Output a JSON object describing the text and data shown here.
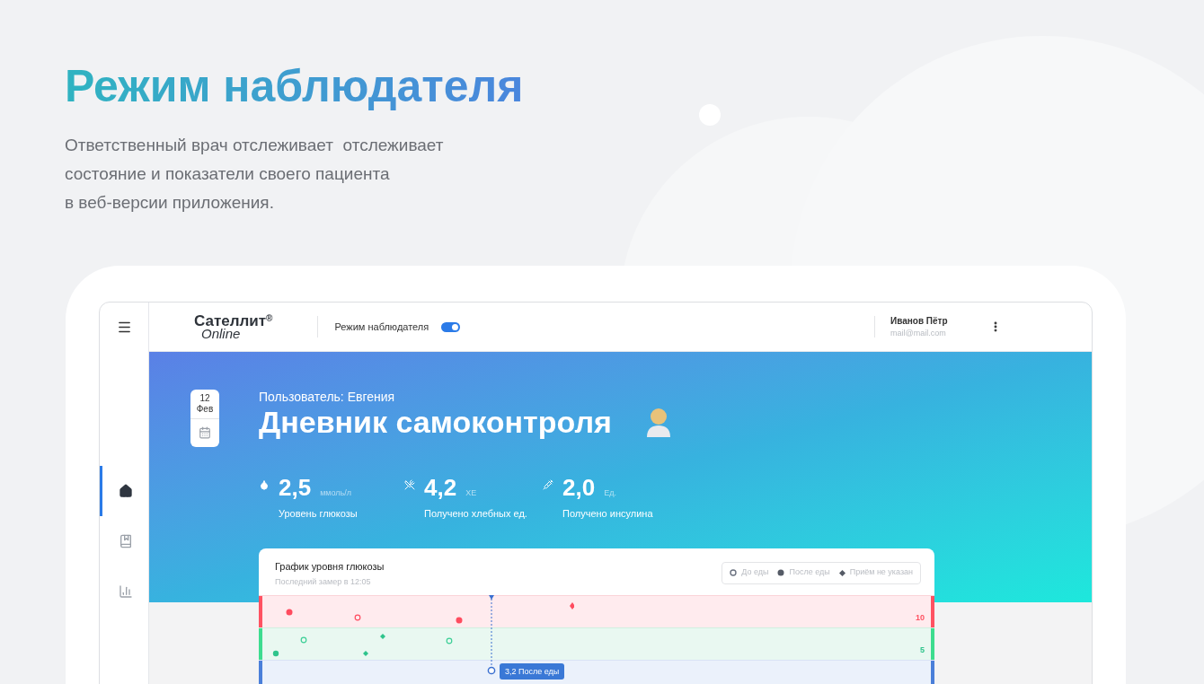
{
  "headline": "Режим наблюдателя",
  "description": "Ответственный врач отслеживает  отслеживает\nсостояние и показатели своего пациента\nв веб-версии приложения.",
  "app": {
    "sidebar": {
      "items": [
        {
          "kind": "home",
          "selected": true
        },
        {
          "kind": "diary",
          "selected": false
        },
        {
          "kind": "stats",
          "selected": false
        }
      ]
    },
    "header": {
      "logo": {
        "name": "Сателлит",
        "mark": "®",
        "sub": "Online"
      },
      "observer_mode": {
        "label": "Режим наблюдателя",
        "on": true
      },
      "user": {
        "name": "Иванов Пётр",
        "email": "mail@mail.com"
      }
    },
    "date": {
      "day": "12",
      "month": "Фев"
    },
    "user_label": "Пользователь: Евгения",
    "title": "Дневник самоконтроля",
    "stats": [
      {
        "kind": "glucose",
        "value": "2,5",
        "unit": "ммоль/л",
        "label": "Уровень глюкозы"
      },
      {
        "kind": "bread_units",
        "value": "4,2",
        "unit": "ХЕ",
        "label": "Получено хлебных ед."
      },
      {
        "kind": "insulin",
        "value": "2,0",
        "unit": "Ед.",
        "label": "Получено инсулина"
      }
    ],
    "chart": {
      "title": "График уровня глюкозы",
      "subtitle": "Последний замер в 12:05",
      "legend": [
        {
          "kind": "before",
          "label": "До еды"
        },
        {
          "kind": "after",
          "label": "После еды"
        },
        {
          "kind": "unspecified",
          "label": "Приём не указан"
        }
      ],
      "bands": [
        {
          "kind": "high",
          "label": "10"
        },
        {
          "kind": "normal",
          "label": "5"
        },
        {
          "kind": "low"
        }
      ],
      "tooltip": "3,2 После еды"
    }
  }
}
